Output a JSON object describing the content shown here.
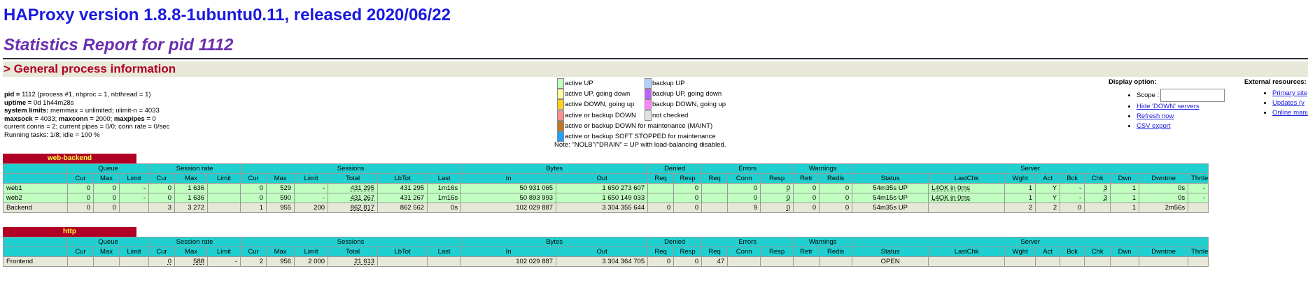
{
  "title": "HAProxy version 1.8.8-1ubuntu0.11, released 2020/06/22",
  "subtitle": "Statistics Report for pid 1112",
  "section": "> General process information",
  "process_info": [
    {
      "b": "pid = ",
      "t": "1112 (process #1, nbproc = 1, nbthread = 1)"
    },
    {
      "b": "uptime = ",
      "t": "0d 1h44m28s"
    },
    {
      "b": "system limits:",
      "t": " memmax = unlimited; ulimit-n = 4033"
    },
    {
      "b": "maxsock = ",
      "t": "4033; ",
      "b2": "maxconn = ",
      "t2": "2000; ",
      "b3": "maxpipes = ",
      "t3": "0"
    },
    {
      "b": "",
      "t": "current conns = 2; current pipes = 0/0; conn rate = 0/sec"
    },
    {
      "b": "",
      "t": "Running tasks: 1/8; idle = 100 %"
    }
  ],
  "legend_left": [
    {
      "color": "#c0ffc0",
      "label": "active UP"
    },
    {
      "color": "#ffffa0",
      "label": "active UP, going down"
    },
    {
      "color": "#ffd020",
      "label": "active DOWN, going up"
    },
    {
      "color": "#ff9090",
      "label": "active or backup DOWN"
    },
    {
      "color": "#c07820",
      "label": "active or backup DOWN for maintenance (MAINT)"
    },
    {
      "color": "#20a0ff",
      "label": "active or backup SOFT STOPPED for maintenance"
    }
  ],
  "legend_right": [
    {
      "color": "#b0d0ff",
      "label": "backup UP"
    },
    {
      "color": "#c060ff",
      "label": "backup UP, going down"
    },
    {
      "color": "#ff80ff",
      "label": "backup DOWN, going up"
    },
    {
      "color": "#e0e0e0",
      "label": "not checked"
    }
  ],
  "legend_note": "Note: \"NOLB\"/\"DRAIN\" = UP with load-balancing disabled.",
  "display_option": {
    "title": "Display option:",
    "scope_label": "Scope :",
    "links": [
      "Hide 'DOWN' servers",
      "Refresh now",
      "CSV export"
    ]
  },
  "external": {
    "title": "External resources:",
    "links": [
      "Primary site",
      "Updates (v",
      "Online manu"
    ]
  },
  "group_headers": [
    "",
    "Queue",
    "Session rate",
    "Sessions",
    "Bytes",
    "Denied",
    "Errors",
    "Warnings",
    "Server"
  ],
  "col_headers": [
    "",
    "Cur",
    "Max",
    "Limit",
    "Cur",
    "Max",
    "Limit",
    "Cur",
    "Max",
    "Limit",
    "Total",
    "LbTot",
    "Last",
    "In",
    "Out",
    "Req",
    "Resp",
    "Req",
    "Conn",
    "Resp",
    "Retr",
    "Redis",
    "Status",
    "LastChk",
    "Wght",
    "Act",
    "Bck",
    "Chk",
    "Dwn",
    "Dwntme",
    "Thrtle"
  ],
  "backend": {
    "name": "web-backend",
    "rows": [
      {
        "kind": "up",
        "cells": [
          "web1",
          "0",
          "0",
          "-",
          "0",
          "1 636",
          "",
          "0",
          "529",
          "-",
          "431 295",
          "431 295",
          "1m16s",
          "50 931 065",
          "1 650 273 607",
          "",
          "0",
          "",
          "0",
          "0",
          "0",
          "0",
          "54m35s UP",
          "L4OK in 0ms",
          "1",
          "Y",
          "-",
          "3",
          "1",
          "0s",
          "-"
        ]
      },
      {
        "kind": "up",
        "cells": [
          "web2",
          "0",
          "0",
          "-",
          "0",
          "1 636",
          "",
          "0",
          "590",
          "-",
          "431 267",
          "431 267",
          "1m16s",
          "50 893 993",
          "1 650 149 033",
          "",
          "0",
          "",
          "0",
          "0",
          "0",
          "0",
          "54m15s UP",
          "L4OK in 0ms",
          "1",
          "Y",
          "-",
          "3",
          "1",
          "0s",
          "-"
        ]
      },
      {
        "kind": "be",
        "cells": [
          "Backend",
          "0",
          "0",
          "",
          "3",
          "3 272",
          "",
          "1",
          "955",
          "200",
          "862 817",
          "862 562",
          "0s",
          "102 029 887",
          "3 304 355 644",
          "0",
          "0",
          "",
          "9",
          "0",
          "0",
          "0",
          "54m35s UP",
          "",
          "2",
          "2",
          "0",
          "",
          "1",
          "2m56s",
          ""
        ]
      }
    ]
  },
  "frontend": {
    "name": "http",
    "rows": [
      {
        "kind": "fe",
        "cells": [
          "Frontend",
          "",
          "",
          "",
          "0",
          "588",
          "-",
          "2",
          "956",
          "2 000",
          "21 613",
          "",
          "",
          "102 029 887",
          "3 304 364 705",
          "0",
          "0",
          "47",
          "",
          "",
          "",
          "",
          "OPEN",
          "",
          "",
          "",
          "",
          "",
          "",
          "",
          ""
        ]
      }
    ]
  }
}
